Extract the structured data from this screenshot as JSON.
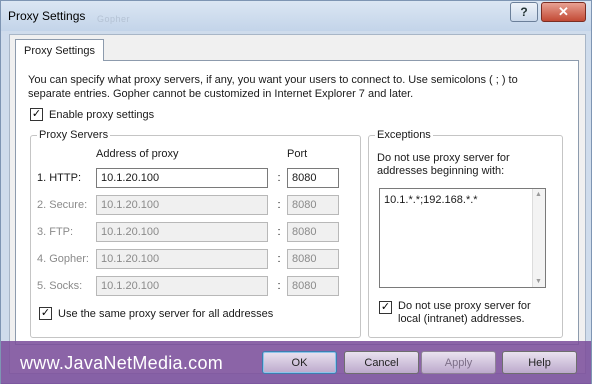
{
  "window": {
    "title": "Proxy Settings",
    "title_ghost": "Gopher",
    "help_glyph": "?",
    "close_glyph": "✕"
  },
  "tab": {
    "label": "Proxy Settings"
  },
  "intro_text": "You can specify what proxy servers, if any, you want your users to connect to. Use semicolons ( ; ) to separate entries. Gopher cannot be customized in Internet Explorer 7 and later.",
  "enable_proxy": {
    "label": "Enable proxy settings",
    "checked": true
  },
  "proxy_servers": {
    "legend": "Proxy Servers",
    "address_header": "Address of proxy",
    "port_header": "Port",
    "separator": ":",
    "rows": [
      {
        "label": "1. HTTP:",
        "address": "10.1.20.100",
        "port": "8080",
        "enabled": true
      },
      {
        "label": "2. Secure:",
        "address": "10.1.20.100",
        "port": "8080",
        "enabled": false
      },
      {
        "label": "3. FTP:",
        "address": "10.1.20.100",
        "port": "8080",
        "enabled": false
      },
      {
        "label": "4. Gopher:",
        "address": "10.1.20.100",
        "port": "8080",
        "enabled": false
      },
      {
        "label": "5. Socks:",
        "address": "10.1.20.100",
        "port": "8080",
        "enabled": false
      }
    ],
    "same_proxy": {
      "label": "Use the same proxy server for all addresses",
      "checked": true
    }
  },
  "exceptions": {
    "legend": "Exceptions",
    "description": "Do not use proxy server for addresses beginning with:",
    "value": "10.1.*.*;192.168.*.*",
    "bypass_local": {
      "label": "Do not use proxy server for local (intranet) addresses.",
      "checked": true
    }
  },
  "footer": {
    "watermark": "www.JavaNetMedia.com",
    "ok": "OK",
    "cancel": "Cancel",
    "apply": "Apply",
    "help": "Help"
  },
  "icons": {
    "check": "✓",
    "scroll_up": "▲",
    "scroll_down": "▼"
  }
}
